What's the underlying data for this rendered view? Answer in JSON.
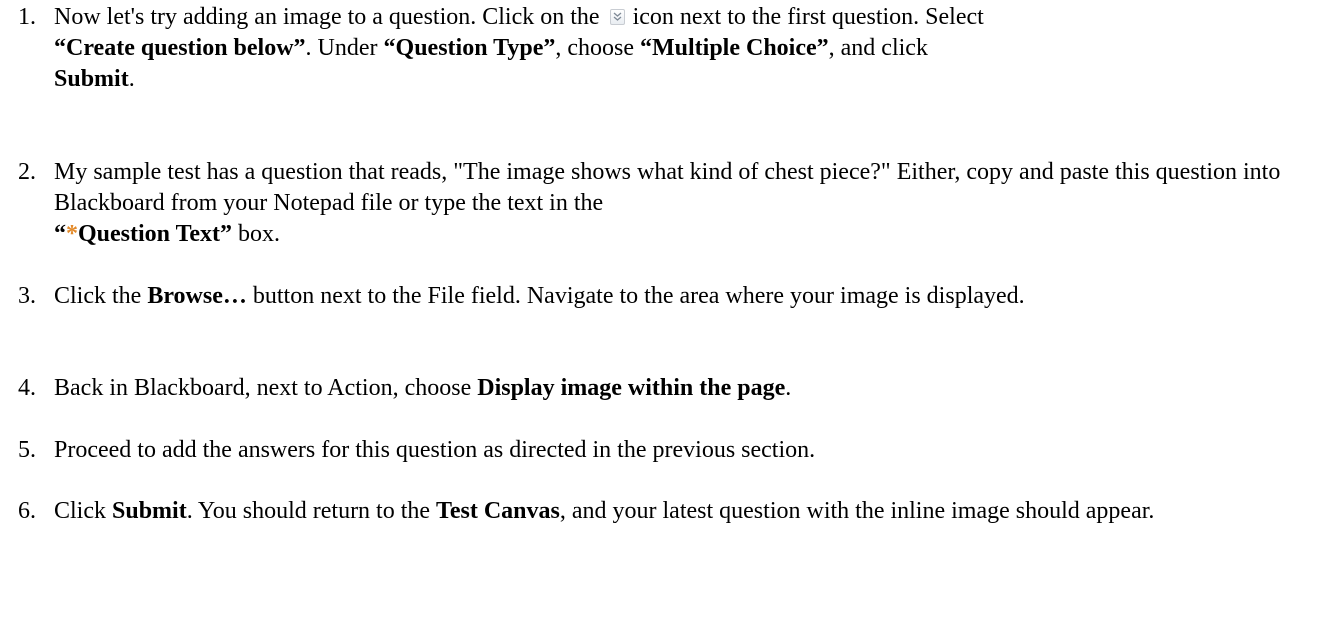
{
  "steps": [
    {
      "number": "1.",
      "segments": [
        "Now let's try adding an image to a question.  Click on the",
        "icon next to the first question.  Select",
        "“Create question below”",
        ". Under",
        "“Question Type”",
        ", choose",
        "“Multiple Choice”",
        ", and click",
        "Submit",
        "."
      ]
    },
    {
      "number": "2.",
      "segments": [
        "My sample test has a question that reads, \"The image shows what kind of chest piece?\"  Either, copy and paste this question into Blackboard from your Notepad file or type the text in the",
        "“",
        "*",
        "Question Text”",
        "box."
      ]
    },
    {
      "number": "3.",
      "segments": [
        "Click the",
        "Browse…",
        "button next to the File field.  Navigate to the area where your image is displayed."
      ]
    },
    {
      "number": "4.",
      "segments": [
        "Back in Blackboard, next to Action, choose",
        "Display image within the page",
        "."
      ]
    },
    {
      "number": "5.",
      "segments": [
        "Proceed to add the answers for this question as directed in the previous section."
      ]
    },
    {
      "number": "6.",
      "segments": [
        "Click",
        "Submit",
        ".  You should return to the",
        "Test Canvas",
        ", and your latest question with the inline image should appear."
      ]
    }
  ],
  "icons": {
    "inline_icon": "action-menu-chevron-icon"
  },
  "colors": {
    "required_asterisk": "#e38a2a"
  }
}
